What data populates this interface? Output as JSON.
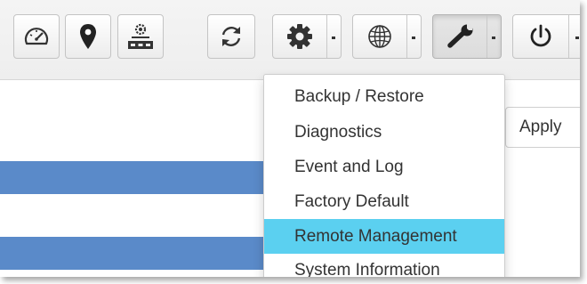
{
  "toolbar": {
    "buttons": [
      {
        "icon": "dashboard-gauge-icon"
      },
      {
        "icon": "location-pin-icon"
      },
      {
        "icon": "network-devices-icon"
      },
      {
        "icon": "refresh-icon"
      }
    ],
    "dropdowns": [
      {
        "icon": "gear-icon"
      },
      {
        "icon": "globe-icon"
      },
      {
        "icon": "wrench-icon",
        "active": true
      },
      {
        "icon": "power-icon"
      }
    ]
  },
  "form": {
    "apply_label": "Apply"
  },
  "tools_menu": {
    "items": [
      {
        "label": "Backup / Restore"
      },
      {
        "label": "Diagnostics"
      },
      {
        "label": "Event and Log"
      },
      {
        "label": "Factory Default"
      },
      {
        "label": "Remote Management",
        "highlighted": true
      },
      {
        "label": "System Information"
      }
    ]
  },
  "colors": {
    "highlight": "#5bd0f0",
    "row_band": "#5a8ac9"
  }
}
